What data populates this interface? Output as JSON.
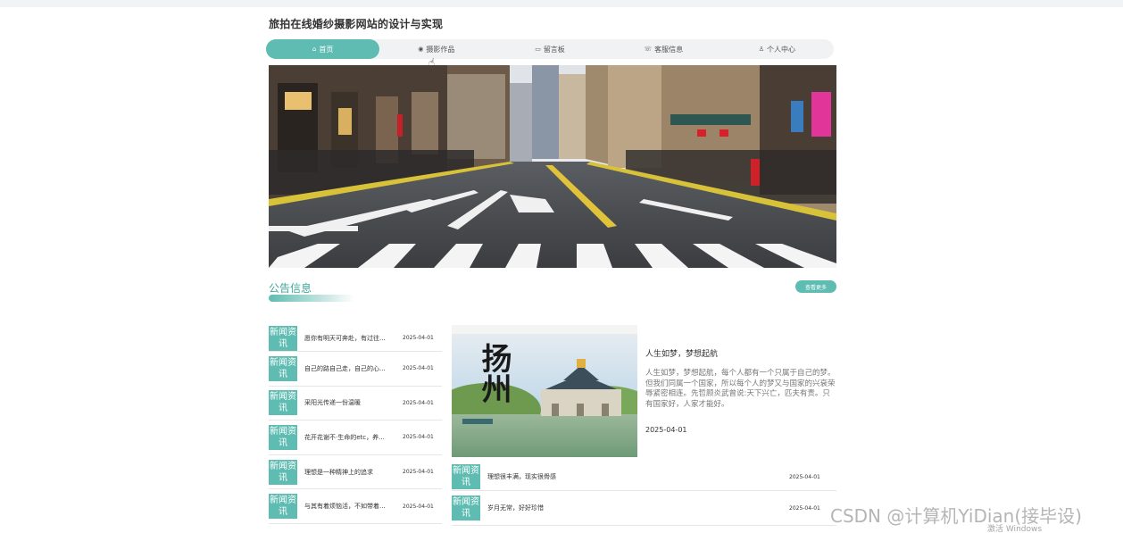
{
  "header": {
    "title": "旅拍在线婚纱摄影网站的设计与实现"
  },
  "nav": {
    "items": [
      {
        "label": "首页",
        "icon": "home-icon",
        "active": true
      },
      {
        "label": "摄影作品",
        "icon": "camera-icon",
        "active": false
      },
      {
        "label": "留言板",
        "icon": "message-icon",
        "active": false
      },
      {
        "label": "客服信息",
        "icon": "service-icon",
        "active": false
      },
      {
        "label": "个人中心",
        "icon": "user-icon",
        "active": false
      }
    ]
  },
  "section": {
    "title": "公告信息",
    "more_label": "查看更多"
  },
  "news_badge": [
    "新闻资",
    "讯"
  ],
  "news_left": [
    {
      "title": "愿你有明天可奔赴，有过往...",
      "date": "2025-04-01"
    },
    {
      "title": "自己的路自己走，自己的心...",
      "date": "2025-04-01"
    },
    {
      "title": "采阳光传递一份温暖",
      "date": "2025-04-01"
    },
    {
      "title": "花开花谢不·生命的etc，养...",
      "date": "2025-04-01"
    },
    {
      "title": "理想是一种精神上的追求",
      "date": "2025-04-01"
    },
    {
      "title": "与其有着烦恼活，不如带着...",
      "date": "2025-04-01"
    }
  ],
  "feature": {
    "image_text": "扬州",
    "title": "人生如梦，梦想起航",
    "text": "人生如梦，梦想起航，每个人都有一个只属于自己的梦。但我们同属一个国家，所以每个人的梦又与国家的兴衰荣辱紧密相连。先哲顾炎武曾说:天下兴亡，匹夫有责。只有国家好，人家才能好。",
    "date": "2025-04-01"
  },
  "news_right": [
    {
      "title": "理想很丰满，现实很骨感",
      "date": "2025-04-01"
    },
    {
      "title": "岁月无常，好好珍惜",
      "date": "2025-04-01"
    }
  ],
  "watermark": {
    "csdn": "CSDN @计算机YiDian(接毕设)",
    "activate": "激活 Windows"
  },
  "colors": {
    "accent": "#5fbcb2",
    "nav_bg": "#f1f2f4"
  }
}
